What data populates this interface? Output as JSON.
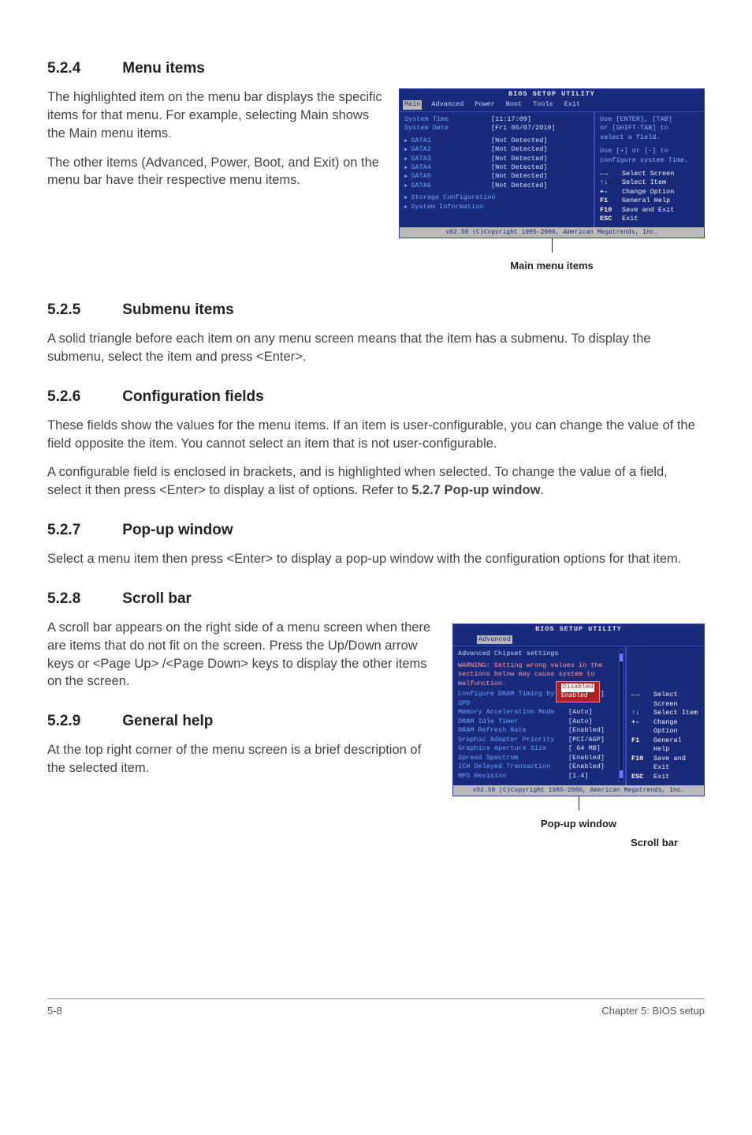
{
  "s524": {
    "num": "5.2.4",
    "title": "Menu items",
    "p1": "The highlighted item on the menu bar displays the specific items for that menu. For example, selecting Main shows the Main menu items.",
    "p2": "The other items (Advanced, Power, Boot, and Exit) on the menu bar have their respective menu items."
  },
  "s525": {
    "num": "5.2.5",
    "title": "Submenu items",
    "p1": "A solid triangle before each item on any menu screen means that the item has a submenu. To display the submenu, select the item and press <Enter>."
  },
  "s526": {
    "num": "5.2.6",
    "title": "Configuration fields",
    "p1": "These fields show the values for the menu items. If an item is user-configurable, you can change the value of the field opposite the item. You cannot select an item that is not user-configurable.",
    "p2": "A configurable field is enclosed in brackets, and is highlighted when selected. To change the value of a field, select it then press <Enter> to display a list of options. Refer to ",
    "p2b": "5.2.7 Pop-up window",
    "p2c": "."
  },
  "s527": {
    "num": "5.2.7",
    "title": "Pop-up window",
    "p1": "Select a menu item then press <Enter> to display a pop-up window with the configuration options for that item."
  },
  "s528": {
    "num": "5.2.8",
    "title": "Scroll bar",
    "p1": "A scroll bar appears on the right side of a menu screen when there are items that do not fit on the screen. Press the Up/Down arrow keys or <Page Up> /<Page Down> keys to display the other items on the screen."
  },
  "s529": {
    "num": "5.2.9",
    "title": "General help",
    "p1": "At the top right corner of the menu screen is a brief description of the selected item."
  },
  "bios1": {
    "titlebar": "BIOS SETUP UTILITY",
    "tabs": [
      "Main",
      "Advanced",
      "Power",
      "Boot",
      "Tools",
      "Exit"
    ],
    "rows": [
      {
        "label": "System Time",
        "val": "[11:17:09]"
      },
      {
        "label": "System Date",
        "val": "[Fri 05/07/2010]"
      }
    ],
    "sata": [
      {
        "label": "SATA1",
        "val": "[Not Detected]"
      },
      {
        "label": "SATA2",
        "val": "[Not Detected]"
      },
      {
        "label": "SATA3",
        "val": "[Not Detected]"
      },
      {
        "label": "SATA4",
        "val": "[Not Detected]"
      },
      {
        "label": "SATA5",
        "val": "[Not Detected]"
      },
      {
        "label": "SATA6",
        "val": "[Not Detected]"
      }
    ],
    "extra": [
      "Storage Configuration",
      "System Information"
    ],
    "help1": "Use [ENTER], [TAB]",
    "help2": "or [SHIFT-TAB] to",
    "help3": "select a field.",
    "help4": "Use [+] or [-] to",
    "help5": "configure system Time.",
    "nav": [
      {
        "k": "←→",
        "v": "Select Screen"
      },
      {
        "k": "↑↓",
        "v": "Select Item"
      },
      {
        "k": "+-",
        "v": "Change Option"
      },
      {
        "k": "F1",
        "v": "General Help"
      },
      {
        "k": "F10",
        "v": "Save and Exit"
      },
      {
        "k": "ESC",
        "v": "Exit"
      }
    ],
    "copy": "v02.58 (C)Copyright 1985-2006, American Megatrends, Inc.",
    "caption": "Main menu items"
  },
  "bios2": {
    "titlebar": "BIOS SETUP UTILITY",
    "tab": "Advanced",
    "heading": "Advanced Chipset settings",
    "warn": "WARNING: Setting wrong values in the sections below may cause system to malfunction.",
    "rows": [
      {
        "label": "Configure DRAM Timing by SPD",
        "val": "[Enabled]"
      },
      {
        "label": "Memory Acceleration Mode",
        "val": "[Auto]"
      },
      {
        "label": "DRAM Idle Timer",
        "val": "[Auto]"
      },
      {
        "label": "DRAM Refresh Rate",
        "val": "[Enabled]"
      },
      {
        "label": "Graphic Adapter Priority",
        "val": "[PCI/AGP]"
      },
      {
        "label": "Graphics Aperture Size",
        "val": "[ 64 MB]"
      },
      {
        "label": "Spread Spectrum",
        "val": "[Enabled]"
      },
      {
        "label": "ICH Delayed Transaction",
        "val": "[Enabled]"
      },
      {
        "label": "MPS Revision",
        "val": "[1.4]"
      }
    ],
    "popup": [
      "Disabled",
      "Enabled"
    ],
    "nav": [
      {
        "k": "←→",
        "v": "Select Screen"
      },
      {
        "k": "↑↓",
        "v": "Select Item"
      },
      {
        "k": "+-",
        "v": "Change Option"
      },
      {
        "k": "F1",
        "v": "General Help"
      },
      {
        "k": "F10",
        "v": "Save and Exit"
      },
      {
        "k": "ESC",
        "v": "Exit"
      }
    ],
    "copy": "v02.58 (C)Copyright 1985-2006, American Megatrends, Inc.",
    "caption_popup": "Pop-up window",
    "caption_scroll": "Scroll bar"
  },
  "footer": {
    "left": "5-8",
    "right": "Chapter 5: BIOS setup"
  }
}
